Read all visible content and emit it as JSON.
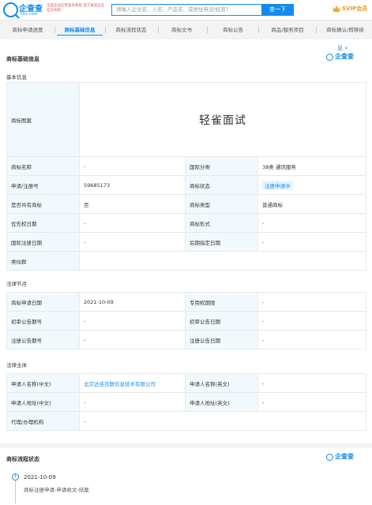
{
  "header": {
    "logo_text": "企查查",
    "logo_sub": "Qcc.com",
    "notice": "全国企业信用查询系统 官方备案企业征信机构",
    "search_placeholder": "请输入企业名、人名、产品名、或地址电话/经营?",
    "search_button": "查一下",
    "vip_label": "SVIP会员"
  },
  "tabs": [
    {
      "label": "商标申请进度",
      "active": false
    },
    {
      "label": "商标基础信息",
      "active": true
    },
    {
      "label": "商标流程状态",
      "active": false
    },
    {
      "label": "商标文书",
      "active": false
    },
    {
      "label": "商标公告",
      "active": false
    },
    {
      "label": "商品/服务项目",
      "active": false
    },
    {
      "label": "商标确认/转移续",
      "active": false
    }
  ],
  "basic_card": {
    "collapse_text": "息 «",
    "title": "商标基础信息",
    "qcc_watermark": "企查查",
    "basic_section": "基本信息",
    "rows": {
      "pattern_label": "商标图案",
      "pattern_text": "轻雀面试",
      "name_label": "商标名称",
      "name_value": "-",
      "intl_class_label": "国际分类",
      "intl_class_value": "38类 通讯服务",
      "reg_no_label": "申请/注册号",
      "reg_no_value": "59685173",
      "status_label": "商标状态",
      "status_value": "注册申请中",
      "shared_label": "是否共有商标",
      "shared_value": "否",
      "type_label": "商标类型",
      "type_value": "普通商标",
      "priority_label": "优先权日期",
      "priority_value": "-",
      "form_label": "商标形式",
      "form_value": "-",
      "intl_reg_label": "国际注册日期",
      "intl_reg_value": "-",
      "later_label": "后期指定日期",
      "later_value": "-",
      "similar_label": "类似群",
      "similar_value": ""
    },
    "legal_section": "法律节点",
    "legal": {
      "apply_date_label": "商标申请日期",
      "apply_date_value": "2021-10-09",
      "exclusive_label": "专用权期限",
      "exclusive_value": "-",
      "prelim_no_label": "初审公告期号",
      "prelim_no_value": "-",
      "prelim_date_label": "初审公告日期",
      "prelim_date_value": "-",
      "reg_no_label": "注册公告期号",
      "reg_no_value": "-",
      "reg_date_label": "注册公告日期",
      "reg_date_value": "-"
    },
    "subject_section": "法律主体",
    "subject": {
      "cn_name_label": "申请人名称(中文)",
      "cn_name_value": "北京达佳互联信息技术有限公司",
      "en_name_label": "申请人名称(英文)",
      "en_name_value": "-",
      "cn_addr_label": "申请人地址(中文)",
      "cn_addr_value": "-",
      "en_addr_label": "申请人地址(英文)",
      "en_addr_value": "-",
      "agent_label": "代理/办理机构",
      "agent_value": "-"
    }
  },
  "process_card": {
    "title": "商标流程状态",
    "qcc_watermark": "企查查",
    "step_number": "1",
    "step_date": "2021-10-09",
    "step_desc": "商标注册申请-申请收文-结案"
  },
  "colors": {
    "accent": "#128bed",
    "label_bg": "#f2f9fc",
    "vip": "#e09a25"
  }
}
